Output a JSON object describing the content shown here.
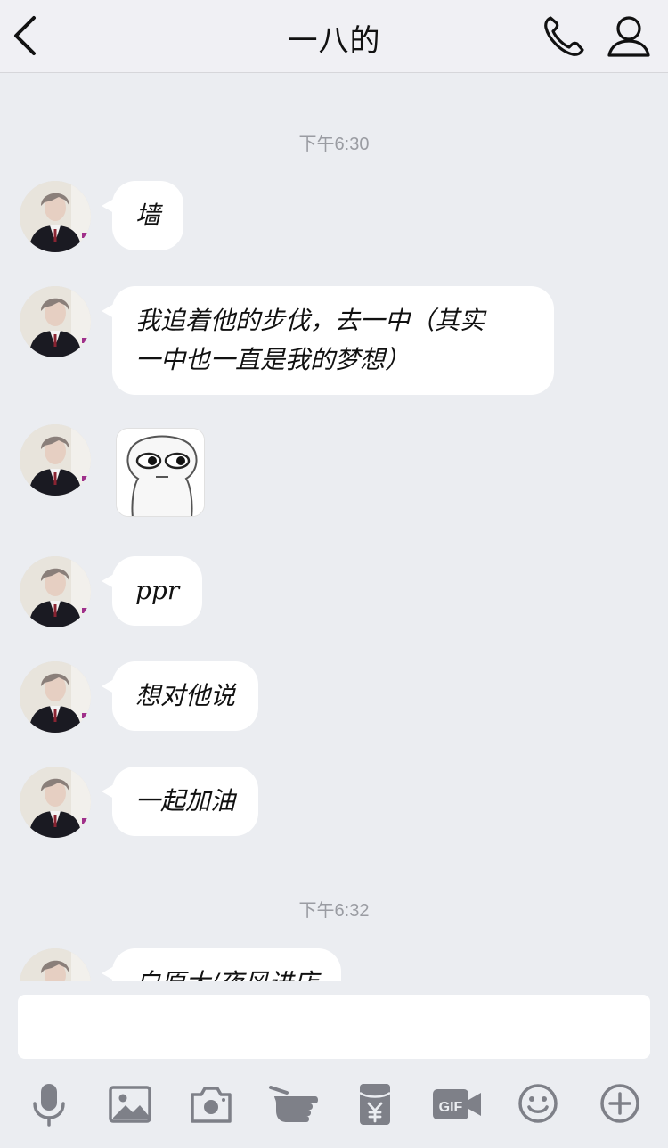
{
  "header": {
    "title": "一八的",
    "back_icon": "chevron-left-icon",
    "call_icon": "phone-icon",
    "profile_icon": "person-icon"
  },
  "timestamps": [
    "下午6:30",
    "下午6:32"
  ],
  "messages": [
    {
      "type": "text",
      "text": "墙"
    },
    {
      "type": "text",
      "lines": [
        "我追着他的步伐，去一中（其实",
        "一中也一直是我的梦想）"
      ]
    },
    {
      "type": "sticker",
      "icon": "meme-face-sticker"
    },
    {
      "type": "text",
      "text": "ppr"
    },
    {
      "type": "text",
      "text": "想对他说"
    },
    {
      "type": "text",
      "text": "一起加油"
    },
    {
      "type": "text",
      "text": "白原大/夜风进店"
    }
  ],
  "input": {
    "value": "",
    "placeholder": ""
  },
  "toolbar": [
    "microphone-icon",
    "image-icon",
    "camera-icon",
    "poke-hand-icon",
    "red-packet-icon",
    "gif-icon",
    "emoji-icon",
    "plus-icon"
  ],
  "colors": {
    "background": "#ebedf1",
    "bubble": "#ffffff",
    "icon": "#7e8088",
    "timestamp": "#9a9ca2"
  }
}
